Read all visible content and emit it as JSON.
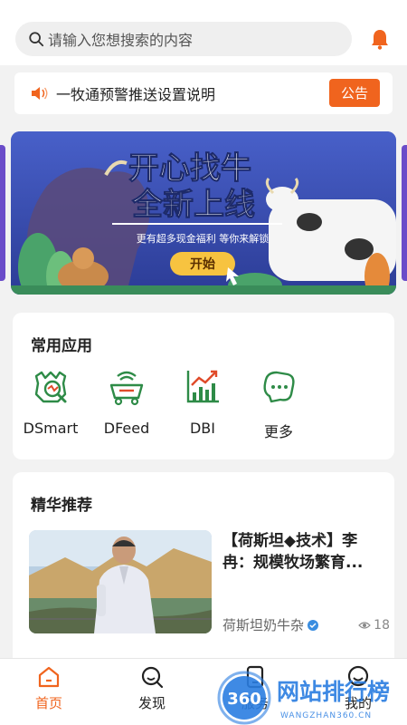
{
  "search": {
    "placeholder": "请输入您想搜索的内容",
    "icon": "search-icon"
  },
  "header": {
    "bell_icon": "bell-icon",
    "accent": "#f0641e"
  },
  "notice": {
    "text": "一牧通预警推送设置说明",
    "button": "公告",
    "icon": "speaker-icon"
  },
  "banner": {
    "title_line1": "开心找牛",
    "title_line2": "全新上线",
    "subtitle": "更有超多现金福利 等你来解锁",
    "cta": "开始"
  },
  "apps": {
    "title": "常用应用",
    "items": [
      {
        "label": "DSmart",
        "icon": "dsmart-icon"
      },
      {
        "label": "DFeed",
        "icon": "dfeed-icon"
      },
      {
        "label": "DBI",
        "icon": "dbi-chart-icon"
      },
      {
        "label": "更多",
        "icon": "more-chat-icon"
      }
    ]
  },
  "featured": {
    "title": "精华推荐",
    "article": {
      "title": "【荷斯坦◆技术】李冉：规模牧场繁育...",
      "source": "荷斯坦奶牛杂",
      "views": "18"
    }
  },
  "tabbar": {
    "items": [
      {
        "label": "首页",
        "icon": "home-icon",
        "active": true
      },
      {
        "label": "发现",
        "icon": "discover-icon",
        "active": false
      },
      {
        "label": "服务",
        "icon": "service-icon",
        "active": false
      },
      {
        "label": "我的",
        "icon": "profile-icon",
        "active": false
      }
    ]
  },
  "watermark": {
    "brand": "网站排行榜",
    "badge": "360",
    "url": "WANGZHAN360.CN"
  }
}
